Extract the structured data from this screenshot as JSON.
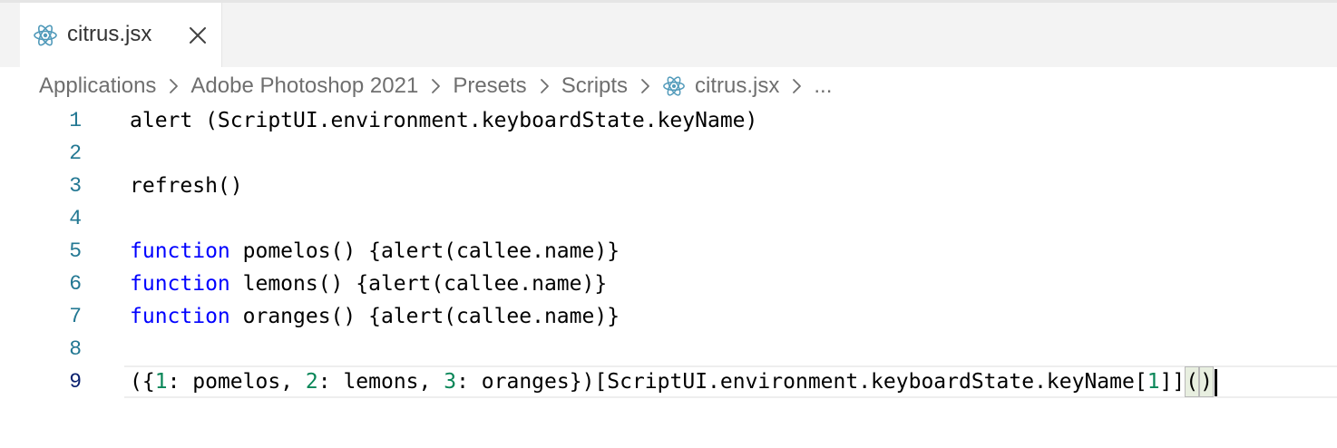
{
  "tab": {
    "title": "citrus.jsx",
    "icon": "react-icon",
    "close_icon": "close-icon"
  },
  "breadcrumb": {
    "items": [
      "Applications",
      "Adobe Photoshop 2021",
      "Presets",
      "Scripts",
      "citrus.jsx",
      "..."
    ],
    "separator_icon": "chevron-right-icon",
    "file_icon": "react-icon"
  },
  "editor": {
    "active_line": 9,
    "line_numbers": [
      "1",
      "2",
      "3",
      "4",
      "5",
      "6",
      "7",
      "8",
      "9"
    ],
    "lines": {
      "l1": "alert (ScriptUI.environment.keyboardState.keyName)",
      "l3": "refresh()",
      "l5_kw": "function",
      "l5_rest": " pomelos() {alert(callee.name)}",
      "l6_kw": "function",
      "l6_rest": " lemons() {alert(callee.name)}",
      "l7_kw": "function",
      "l7_rest": " oranges() {alert(callee.name)}",
      "l9_a": "({",
      "l9_n1": "1",
      "l9_b": ": pomelos, ",
      "l9_n2": "2",
      "l9_c": ": lemons, ",
      "l9_n3": "3",
      "l9_d": ": oranges})[ScriptUI.environment.keyboardState.keyName[",
      "l9_n4": "1",
      "l9_e": "]]",
      "l9_open": "(",
      "l9_close": ")"
    }
  },
  "colors": {
    "keyword": "#0000ff",
    "number": "#098658",
    "line_number": "#237893",
    "active_line_number": "#0b216f",
    "react_icon": "#519aba"
  }
}
